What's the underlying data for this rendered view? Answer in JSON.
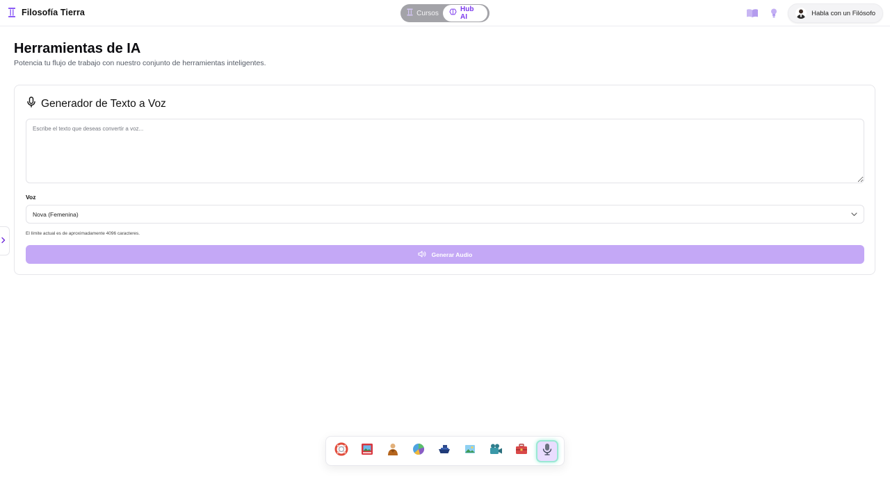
{
  "header": {
    "brand_title": "Filosofía Tierra",
    "tabs": [
      {
        "label": "Cursos",
        "active": false
      },
      {
        "label": "Hub AI",
        "active": true
      }
    ],
    "talk_button_label": "Habla con un Filósofo"
  },
  "page": {
    "title": "Herramientas de IA",
    "subtitle": "Potencia tu flujo de trabajo con nuestro conjunto de herramientas inteligentes."
  },
  "tool": {
    "title": "Generador de Texto a Voz",
    "text_placeholder": "Escribe el texto que deseas convertir a voz...",
    "text_value": "",
    "voice_label": "Voz",
    "voice_selected": "Nova (Femenina)",
    "limit_hint": "El límite actual es de aproximadamente 4096 caracteres.",
    "generate_button_label": "Generar Audio"
  },
  "dock": {
    "items": [
      {
        "icon": "lifebuoy-icon",
        "active": false
      },
      {
        "icon": "photo-book-icon",
        "active": false
      },
      {
        "icon": "monk-figure-icon",
        "active": false
      },
      {
        "icon": "pie-chart-icon",
        "active": false
      },
      {
        "icon": "ship-icon",
        "active": false
      },
      {
        "icon": "landscape-image-icon",
        "active": false
      },
      {
        "icon": "video-camera-icon",
        "active": false
      },
      {
        "icon": "toolbox-icon",
        "active": false
      },
      {
        "icon": "microphone-icon",
        "active": true
      }
    ]
  },
  "colors": {
    "accent": "#7c3aed",
    "button_bg": "#c4a8f6",
    "segmented_bg": "#a3a3a8",
    "active_dock_border": "#9be8d4"
  }
}
